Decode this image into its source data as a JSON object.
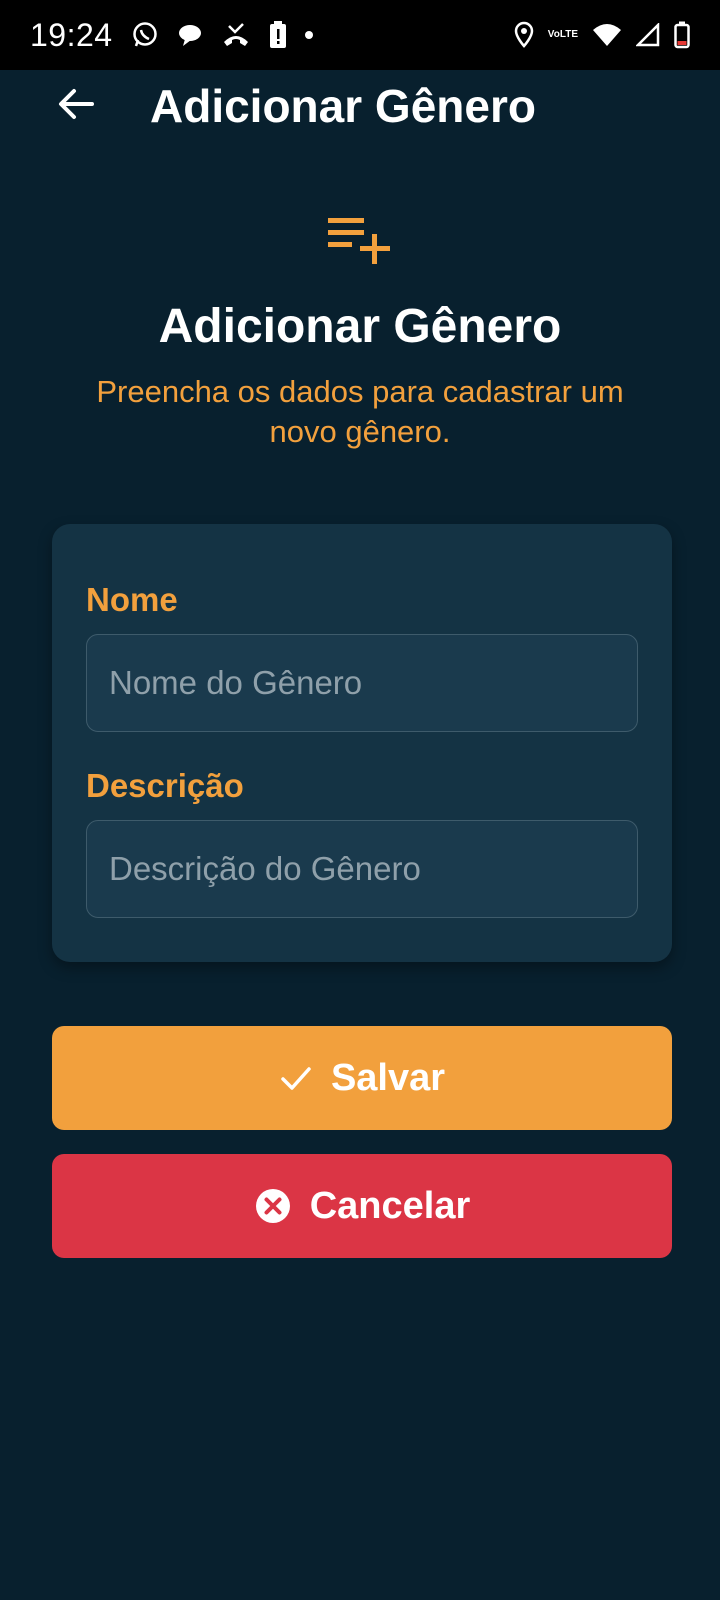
{
  "status_bar": {
    "time": "19:24",
    "left_icons": [
      "whatsapp-icon",
      "chat-bubble-icon",
      "missed-call-icon",
      "battery-alert-icon",
      "notification-dot"
    ],
    "volte_label_top": "Vo",
    "volte_label_bottom": "LTE",
    "right_icons": [
      "location-icon",
      "volte-icon",
      "wifi-icon",
      "signal-icon",
      "battery-icon"
    ]
  },
  "app_bar": {
    "back_icon": "arrow-left-icon",
    "title": "Adicionar Gênero"
  },
  "header": {
    "icon": "playlist-add-icon",
    "title": "Adicionar Gênero",
    "subtitle": "Preencha os dados para cadastrar um novo gênero."
  },
  "form": {
    "name_label": "Nome",
    "name_placeholder": "Nome do Gênero",
    "name_value": "",
    "description_label": "Descrição",
    "description_placeholder": "Descrição do Gênero",
    "description_value": ""
  },
  "actions": {
    "save_label": "Salvar",
    "save_icon": "check-icon",
    "cancel_label": "Cancelar",
    "cancel_icon": "cancel-circle-icon"
  },
  "colors": {
    "background": "#08202e",
    "card": "#143344",
    "accent": "#f2a03d",
    "danger": "#db3545",
    "text": "#ffffff",
    "placeholder": "#8fa0aa"
  }
}
